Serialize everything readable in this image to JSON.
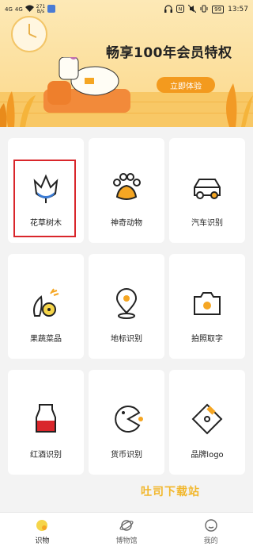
{
  "status_bar": {
    "signal_left": "4G",
    "signal_right": "4G",
    "net_speed_value": "271",
    "net_speed_unit": "B/s",
    "battery": "99",
    "time": "13:57"
  },
  "banner": {
    "title": "畅享100年会员特权",
    "button": "立即体验"
  },
  "categories": [
    {
      "label": "花草树木",
      "icon": "flower-icon"
    },
    {
      "label": "神奇动物",
      "icon": "paw-icon"
    },
    {
      "label": "汽车识别",
      "icon": "car-icon"
    },
    {
      "label": "果蔬菜品",
      "icon": "fruit-icon"
    },
    {
      "label": "地标识别",
      "icon": "location-pin-icon"
    },
    {
      "label": "拍照取字",
      "icon": "camera-icon"
    },
    {
      "label": "红酒识别",
      "icon": "wine-glass-icon"
    },
    {
      "label": "货币识别",
      "icon": "coin-icon"
    },
    {
      "label": "品牌logo",
      "icon": "tag-icon"
    }
  ],
  "watermark": "吐司下载站",
  "nav": [
    {
      "label": "识物",
      "icon": "identify-icon",
      "active": true
    },
    {
      "label": "博物馆",
      "icon": "planet-icon",
      "active": false
    },
    {
      "label": "我的",
      "icon": "profile-icon",
      "active": false
    }
  ],
  "colors": {
    "accent": "#f39a1e",
    "highlight": "#d9262b",
    "icon_blue": "#3a7bd5",
    "icon_orange": "#f5a623"
  }
}
